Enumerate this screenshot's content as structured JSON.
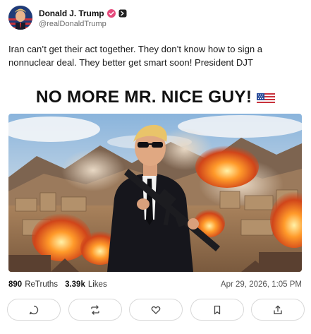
{
  "author": {
    "display_name": "Donald J. Trump",
    "handle": "@realDonaldTrump",
    "verified": true,
    "avatar_icon": "profile-photo-avatar"
  },
  "post": {
    "text": "Iran can’t get their act together. They don’t know how to sign a nonnuclear deal. They better get smart soon! President DJT",
    "headline": "NO MORE MR. NICE GUY!",
    "headline_emoji": "us-flag-icon",
    "media_description_icon": "attached-image"
  },
  "stats": {
    "retruths_count": "890",
    "retruths_label": "ReTruths",
    "likes_count": "3.39k",
    "likes_label": "Likes",
    "timestamp": "Apr 29, 2026, 1:05 PM"
  },
  "actions": [
    {
      "icon": "reply-icon"
    },
    {
      "icon": "retruth-icon"
    },
    {
      "icon": "like-icon"
    },
    {
      "icon": "bookmark-icon"
    },
    {
      "icon": "share-icon"
    }
  ],
  "colors": {
    "verified": "#e5497b",
    "text": "#1a1a1a",
    "muted": "#6b6b6b",
    "border": "#d8d8d8"
  }
}
